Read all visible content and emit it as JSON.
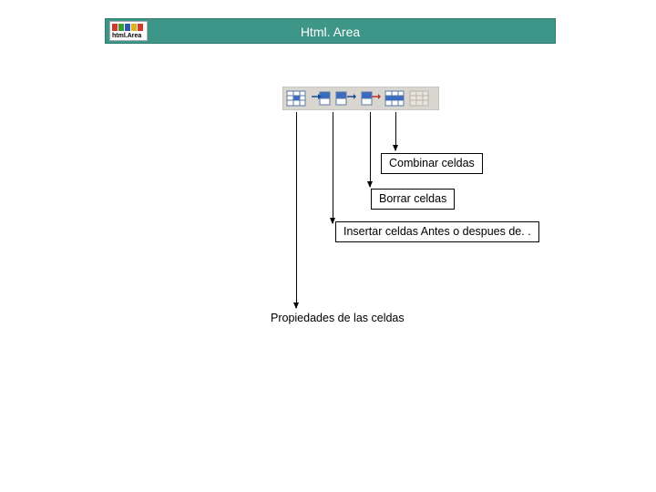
{
  "header": {
    "title": "Html. Area",
    "logo_text": "html.Area"
  },
  "toolbar": {
    "buttons": [
      {
        "name": "cell-properties-icon"
      },
      {
        "name": "insert-cell-before-icon"
      },
      {
        "name": "insert-cell-after-icon"
      },
      {
        "name": "delete-cell-icon"
      },
      {
        "name": "merge-cells-icon"
      },
      {
        "name": "split-cell-icon"
      }
    ]
  },
  "callouts": {
    "merge": "Combinar celdas",
    "delete": "Borrar celdas",
    "insert": "Insertar celdas Antes o despues de. .",
    "properties": "Propiedades de las celdas"
  }
}
